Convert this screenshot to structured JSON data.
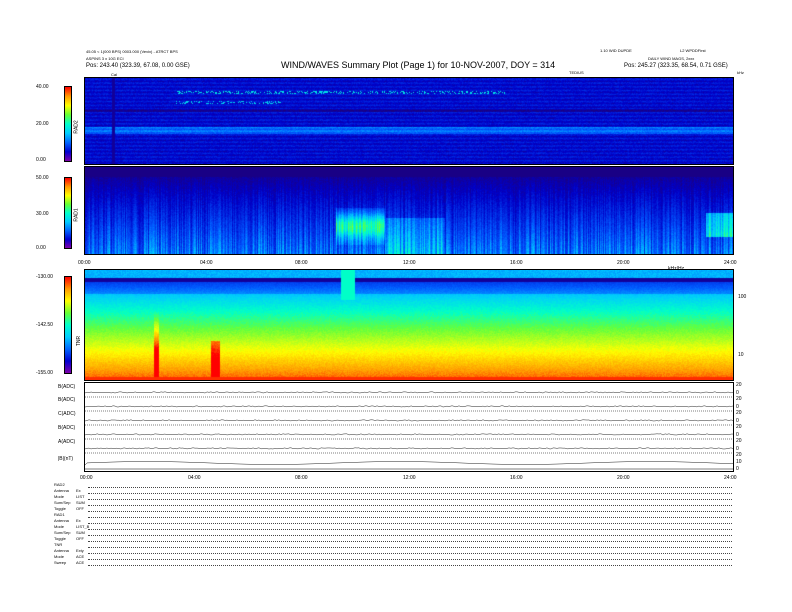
{
  "header": {
    "title": "WIND/WAVES Summary Plot (Page 1) for 10-NOV-2007, DOY = 314",
    "left_line1": "45.05 < 1(000 BPS) 0003.000 (Vevix) - ATRCT BPS",
    "left_line2": "ASPINS 3 x 10G ECI",
    "left_pos": "Pos:   243.40 (323.39, 67.08, 0.00 GSE)",
    "right_line1": "1.10 WID DUPDE",
    "right_line2": "L2 WPDDFirst",
    "right_line3": "DAILY WIND MAGS, 2xxx",
    "right_pos": "Pos:   245.27 (323.35, 68.54, 0.71 GSE)",
    "time_label": "TEDIUS",
    "marker_label": "Cal",
    "corner_label": "kHz",
    "reset_label": "kHz/Hz"
  },
  "rad2": {
    "name": "RAD2",
    "ticks": [
      "40.00",
      "20.00",
      "0.00"
    ]
  },
  "rad1": {
    "name": "RAD1",
    "ticks": [
      "50.00",
      "30.00",
      "0.00"
    ]
  },
  "tnr": {
    "name": "TNR",
    "ticks": [
      "-130.00",
      "-142.50",
      "-155.00"
    ],
    "right_ticks": [
      "100",
      "10"
    ]
  },
  "time_axis": {
    "labels": [
      "00:00",
      "04:00",
      "08:00",
      "12:00",
      "16:00",
      "20:00",
      "24:00"
    ]
  },
  "traces": {
    "labels": [
      "B(ADC)",
      "B(ADC)",
      "C(ADC)",
      "B(ADC)",
      "A(ADC)",
      "|B|(nT)"
    ],
    "right_vals": [
      [
        "20",
        "0"
      ],
      [
        "20",
        "0"
      ],
      [
        "20",
        "0"
      ],
      [
        "20",
        "0"
      ],
      [
        "20",
        "0"
      ],
      [
        "20",
        "10",
        "0"
      ]
    ]
  },
  "footer": {
    "rows": [
      {
        "k": "RAD2",
        "v": ""
      },
      {
        "k": "Antenna",
        "v": "Ex"
      },
      {
        "k": "Mode",
        "v": "LIST"
      },
      {
        "k": "Sum/Sep",
        "v": "SUM"
      },
      {
        "k": "Toggle",
        "v": "OFF"
      },
      {
        "k": "RAD1",
        "v": ""
      },
      {
        "k": "Antenna",
        "v": "Ex"
      },
      {
        "k": "Mode",
        "v": "LIST_B"
      },
      {
        "k": "Sum/Sep",
        "v": "SUM"
      },
      {
        "k": "Toggle",
        "v": "OFF"
      },
      {
        "k": "TNR",
        "v": ""
      },
      {
        "k": "Antenna",
        "v": "Exty"
      },
      {
        "k": "Mode",
        "v": "ACE"
      },
      {
        "k": "Sweep",
        "v": "ACE"
      }
    ]
  },
  "colors": {
    "scale": [
      "#7f00a8",
      "#0000d0",
      "#0066ff",
      "#00ccff",
      "#00ffcc",
      "#66ff33",
      "#ffff00",
      "#ff9900",
      "#ff0000"
    ]
  }
}
